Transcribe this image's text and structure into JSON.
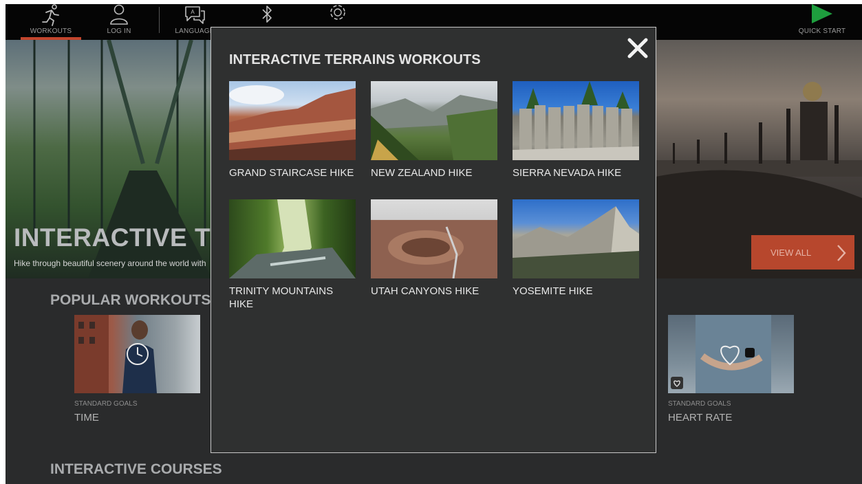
{
  "nav": {
    "items": [
      {
        "label": "WORKOUTS",
        "icon": "runner-icon"
      },
      {
        "label": "LOG IN",
        "icon": "user-icon"
      },
      {
        "label": "LANGUAGE",
        "icon": "language-icon"
      },
      {
        "label": "",
        "icon": "bluetooth-icon"
      },
      {
        "label": "",
        "icon": "gear-icon"
      }
    ],
    "quick_start": {
      "label": "QUICK START",
      "icon": "play-icon"
    },
    "accent": "#c2452d"
  },
  "hero": {
    "title": "INTERACTIVE TERRAINS WORKOUTS",
    "subtitle": "Hike through beautiful scenery around the world with",
    "view_all": "VIEW ALL"
  },
  "popular": {
    "title": "POPULAR WORKOUTS",
    "cards": [
      {
        "kicker": "STANDARD GOALS",
        "label": "TIME",
        "icon": "clock-icon"
      },
      {
        "kicker": "STANDARD GOALS",
        "label": "HEART RATE",
        "icon": "heart-icon"
      }
    ]
  },
  "courses": {
    "title": "INTERACTIVE COURSES"
  },
  "modal": {
    "title": "INTERACTIVE TERRAINS WORKOUTS",
    "close_icon": "close-icon",
    "tiles": [
      {
        "label": "GRAND STAIRCASE HIKE"
      },
      {
        "label": "NEW ZEALAND HIKE"
      },
      {
        "label": "SIERRA NEVADA HIKE"
      },
      {
        "label": "TRINITY MOUNTAINS HIKE"
      },
      {
        "label": "UTAH CANYONS HIKE"
      },
      {
        "label": "YOSEMITE HIKE"
      }
    ]
  },
  "colors": {
    "quick_start_green": "#1e9e3e",
    "view_all_bg": "#b7472d"
  }
}
